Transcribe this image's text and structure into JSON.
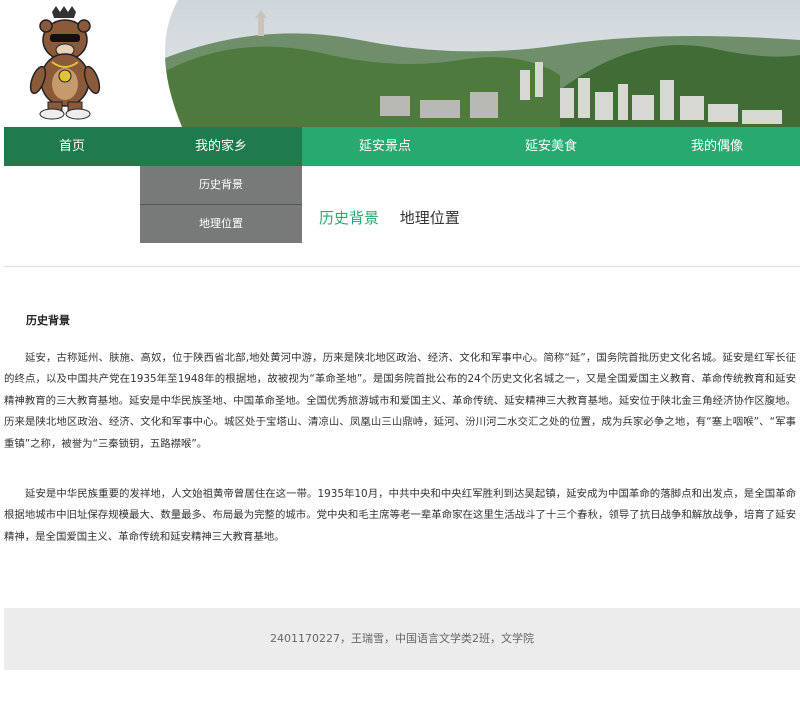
{
  "nav": {
    "items": [
      "首页",
      "我的家乡",
      "延安景点",
      "延安美食",
      "我的偶像"
    ]
  },
  "dropdown": {
    "items": [
      "历史背景",
      "地理位置"
    ]
  },
  "tabs": [
    "历史背景",
    "地理位置"
  ],
  "content": {
    "title": "历史背景",
    "paragraphs": [
      "延安，古称延州、肤施、高奴，位于陕西省北部,地处黄河中游，历来是陕北地区政治、经济、文化和军事中心。简称“延”，国务院首批历史文化名城。延安是红军长征的终点，以及中国共产党在1935年至1948年的根据地，故被视为“革命圣地”。是国务院首批公布的24个历史文化名城之一，又是全国爱国主义教育、革命传统教育和延安精神教育的三大教育基地。延安是中华民族圣地、中国革命圣地。全国优秀旅游城市和爱国主义、革命传统、延安精神三大教育基地。延安位于陕北金三角经济协作区腹地。历来是陕北地区政治、经济、文化和军事中心。城区处于宝塔山、清凉山、凤凰山三山鼎峙，延河、汾川河二水交汇之处的位置，成为兵家必争之地，有“塞上咽喉”、“军事重镇”之称，被誉为“三秦锁钥，五路襟喉”。",
      "延安是中华民族重要的发祥地，人文始祖黄帝曾居住在这一带。1935年10月，中共中央和中央红军胜利到达吴起镇，延安成为中国革命的落脚点和出发点，是全国革命根据地城市中旧址保存规模最大、数量最多、布局最为完整的城市。党中央和毛主席等老一辈革命家在这里生活战斗了十三个春秋，领导了抗日战争和解放战争，培育了延安精神，是全国爱国主义、革命传统和延安精神三大教育基地。"
    ]
  },
  "footer": {
    "text": "2401170227，王瑞雪，中国语言文学类2班，文学院"
  },
  "colors": {
    "nav_green": "#27a96f",
    "nav_dark": "#1f7a4c",
    "dropdown_gray": "#777a78",
    "footer_bg": "#ececec"
  }
}
